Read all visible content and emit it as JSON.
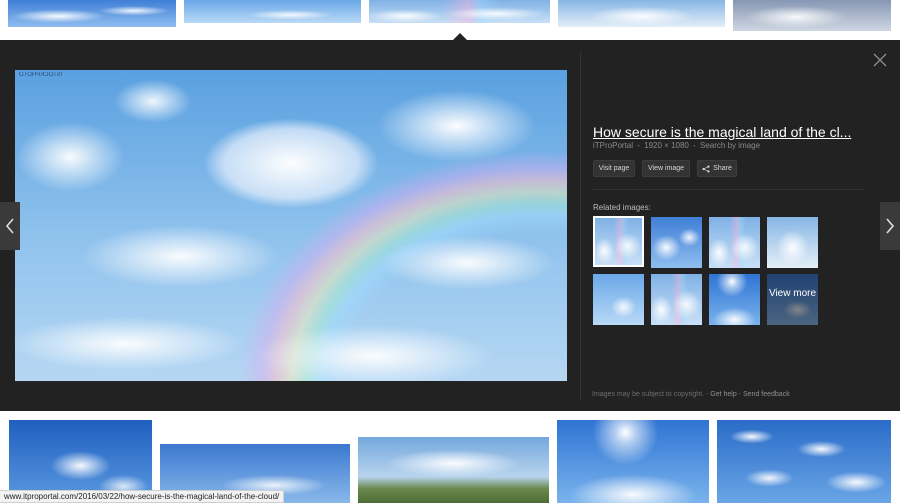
{
  "viewer": {
    "watermark": "ISTOCKPHOTO",
    "title": "How secure is the magical land of the cl...",
    "source": "iTProPortal",
    "dimensions": "1920 × 1080",
    "separator": "-",
    "search_by_image": "Search by image",
    "visit_page_label": "Visit page",
    "view_image_label": "View image",
    "share_label": "Share",
    "related_label": "Related images:",
    "view_more_label": "View more",
    "copyright_notice": "Images may be subject to copyright.",
    "get_help": "Get help",
    "send_feedback": "Send feedback"
  },
  "status_bar": {
    "url": "www.itproportal.com/2016/03/22/how-secure-is-the-magical-land-of-the-cloud/"
  },
  "icons": {
    "close": "close-icon",
    "prev": "chevron-left-icon",
    "next": "chevron-right-icon",
    "share": "share-icon"
  },
  "colors": {
    "panel_bg": "#222222",
    "button_bg": "#333333",
    "title_text": "#ffffff",
    "meta_text": "#8a8a8a"
  }
}
